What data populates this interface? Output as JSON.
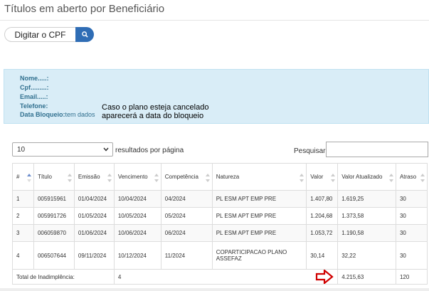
{
  "page": {
    "title": "Títulos em aberto por Beneficiário"
  },
  "cpf": {
    "button_label": "Digitar o CPF",
    "search_icon": "search-icon"
  },
  "info": {
    "nome_label": "Nome.....:",
    "cpf_label": "Cpf.........:",
    "email_label": "Email.....:",
    "telefone_label": "Telefone:",
    "bloqueio_label": "Data Bloqueio:",
    "bloqueio_value": "tem dados",
    "note_line1": "Caso o plano esteja cancelado",
    "note_line2": "aparecerá a data do bloqueio"
  },
  "controls": {
    "page_length": "10",
    "page_length_suffix": "resultados por página",
    "search_label": "Pesquisar"
  },
  "table": {
    "headers": [
      "#",
      "Título",
      "Emissão",
      "Vencimento",
      "Competência",
      "Natureza",
      "Valor",
      "Valor Atualizado",
      "Atraso"
    ],
    "rows": [
      [
        "1",
        "005915961",
        "01/04/2024",
        "10/04/2024",
        "04/2024",
        "PL ESM APT EMP PRE",
        "1.407,80",
        "1.619,25",
        "30"
      ],
      [
        "2",
        "005991726",
        "01/05/2024",
        "10/05/2024",
        "05/2024",
        "PL ESM APT EMP PRE",
        "1.204,68",
        "1.373,58",
        "30"
      ],
      [
        "3",
        "006059870",
        "01/06/2024",
        "10/06/2024",
        "06/2024",
        "PL ESM APT EMP PRE",
        "1.053,72",
        "1.190,58",
        "30"
      ],
      [
        "4",
        "006507644",
        "09/11/2024",
        "10/12/2024",
        "11/2024",
        "COPARTICIPACAO PLANO ASSEFAZ",
        "30,14",
        "32,22",
        "30"
      ]
    ],
    "footer": {
      "label": "Total de Inadimplência:",
      "count": "4",
      "total": "4.215,63",
      "atraso": "120"
    }
  },
  "colors": {
    "accent": "#2f6db5",
    "info_bg": "#d9edf7",
    "info_text": "#31708f",
    "highlight": "#d00000"
  }
}
